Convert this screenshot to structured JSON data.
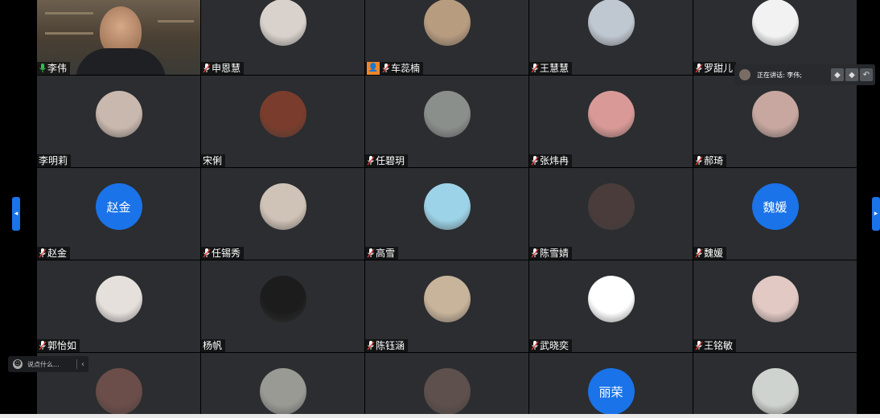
{
  "participants": [
    {
      "name": "李伟",
      "avatar": "video",
      "speaking": true,
      "mic": "active"
    },
    {
      "name": "申恩慧",
      "avatar": "photo",
      "color": "#d9d2cc",
      "mic": "muted"
    },
    {
      "name": "车蕊楠",
      "avatar": "photo",
      "color": "#b89c80",
      "mic": "muted",
      "host": true
    },
    {
      "name": "王慧慧",
      "avatar": "photo",
      "color": "#bfc7d0",
      "mic": "muted"
    },
    {
      "name": "罗甜儿",
      "avatar": "photo",
      "color": "#f2f2f2",
      "mic": "muted"
    },
    {
      "name": "李明莉",
      "avatar": "photo",
      "color": "#c9b8ae",
      "mic": "none"
    },
    {
      "name": "宋俐",
      "avatar": "photo",
      "color": "#7a3c2c",
      "mic": "none"
    },
    {
      "name": "任碧玥",
      "avatar": "photo",
      "color": "#8a8f8c",
      "mic": "muted"
    },
    {
      "name": "张炜冉",
      "avatar": "photo",
      "color": "#d99a97",
      "mic": "muted"
    },
    {
      "name": "郝琦",
      "avatar": "photo",
      "color": "#c7a7a0",
      "mic": "muted"
    },
    {
      "name": "赵金",
      "avatar": "text",
      "avatar_text": "赵金",
      "mic": "muted"
    },
    {
      "name": "任锡秀",
      "avatar": "photo",
      "color": "#cfc2b6",
      "mic": "muted"
    },
    {
      "name": "高雪",
      "avatar": "photo",
      "color": "#9dd3e8",
      "mic": "muted"
    },
    {
      "name": "陈雪婧",
      "avatar": "photo",
      "color": "#4a3c3a",
      "mic": "muted"
    },
    {
      "name": "魏媛",
      "avatar": "text",
      "avatar_text": "魏媛",
      "mic": "muted"
    },
    {
      "name": "郭怡如",
      "avatar": "photo",
      "color": "#e6e0dc",
      "mic": "muted"
    },
    {
      "name": "杨帆",
      "avatar": "photo",
      "color": "#1c1c1c",
      "mic": "none"
    },
    {
      "name": "陈钰涵",
      "avatar": "photo",
      "color": "#c8b49b",
      "mic": "muted"
    },
    {
      "name": "武晓奕",
      "avatar": "photo",
      "color": "#ffffff",
      "mic": "muted"
    },
    {
      "name": "王铭敏",
      "avatar": "photo",
      "color": "#e2c9c4",
      "mic": "muted"
    },
    {
      "name": "",
      "avatar": "photo",
      "color": "#6b4d49",
      "mic": "none"
    },
    {
      "name": "",
      "avatar": "photo",
      "color": "#9a9a95",
      "mic": "none"
    },
    {
      "name": "",
      "avatar": "photo",
      "color": "#5e504c",
      "mic": "none"
    },
    {
      "name": "",
      "avatar": "text",
      "avatar_text": "丽荣",
      "mic": "none"
    },
    {
      "name": "",
      "avatar": "photo",
      "color": "#cfd3cf",
      "mic": "none"
    }
  ],
  "speaker_indicator": {
    "text": "正在讲话: 李伟;"
  },
  "chat": {
    "placeholder": "说点什么..."
  },
  "colors": {
    "tile_bg": "#2b2d30",
    "accent": "#1a73e8",
    "speaking_border": "#2ec04f",
    "host_badge": "#f0862a"
  }
}
